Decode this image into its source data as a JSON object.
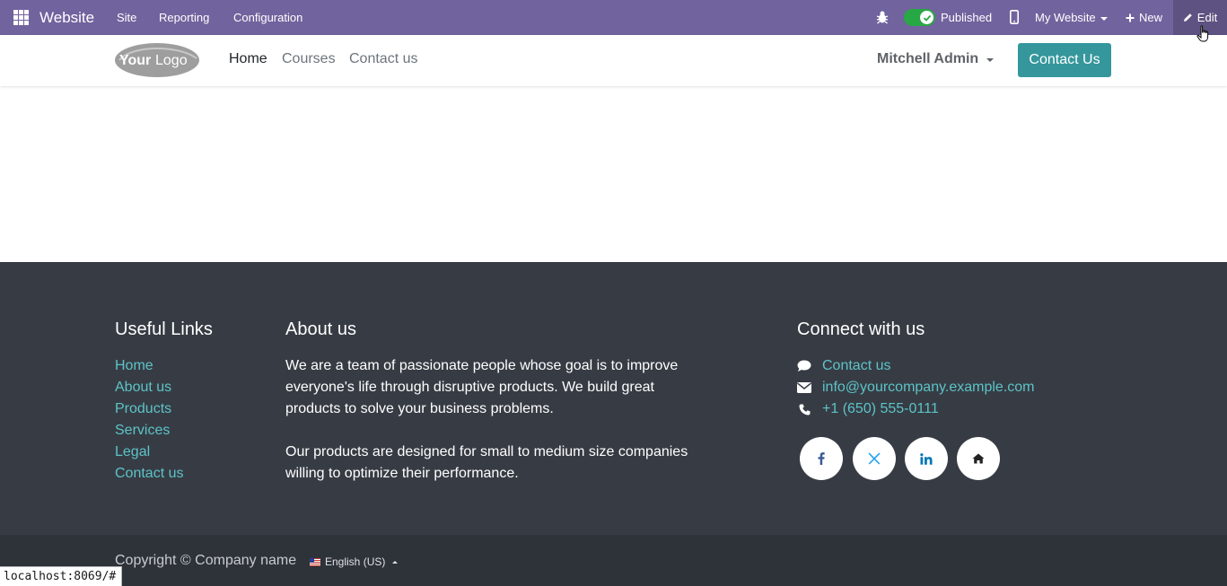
{
  "adminbar": {
    "brand": "Website",
    "menus": [
      "Site",
      "Reporting",
      "Configuration"
    ],
    "published_label": "Published",
    "website_select": "My Website",
    "new_label": "New",
    "edit_label": "Edit",
    "color": "#71639e"
  },
  "header": {
    "logo_text_bold": "Your",
    "logo_text_light": "Logo",
    "nav": [
      "Home",
      "Courses",
      "Contact us"
    ],
    "active_nav": "Home",
    "user": "Mitchell Admin",
    "cta": "Contact Us",
    "cta_color": "#35979c"
  },
  "footer": {
    "links_title": "Useful Links",
    "links": [
      "Home",
      "About us",
      "Products",
      "Services",
      "Legal",
      "Contact us"
    ],
    "about_title": "About us",
    "about_p1": "We are a team of passionate people whose goal is to improve everyone's life through disruptive products. We build great products to solve your business problems.",
    "about_p2": "Our products are designed for small to medium size companies willing to optimize their performance.",
    "connect_title": "Connect with us",
    "contacts": [
      {
        "icon": "comment-icon",
        "text": "Contact us"
      },
      {
        "icon": "envelope-icon",
        "text": "info@yourcompany.example.com"
      },
      {
        "icon": "phone-icon",
        "text": "+1 (650) 555-0111"
      }
    ],
    "social": [
      "facebook-icon",
      "x-twitter-icon",
      "linkedin-icon",
      "home-icon"
    ],
    "background": "#373c44",
    "link_color": "#5cc3c8"
  },
  "copyright": {
    "text": "Copyright © Company name",
    "language": "English (US)"
  },
  "statusbar": {
    "url": "localhost:8069/#"
  }
}
